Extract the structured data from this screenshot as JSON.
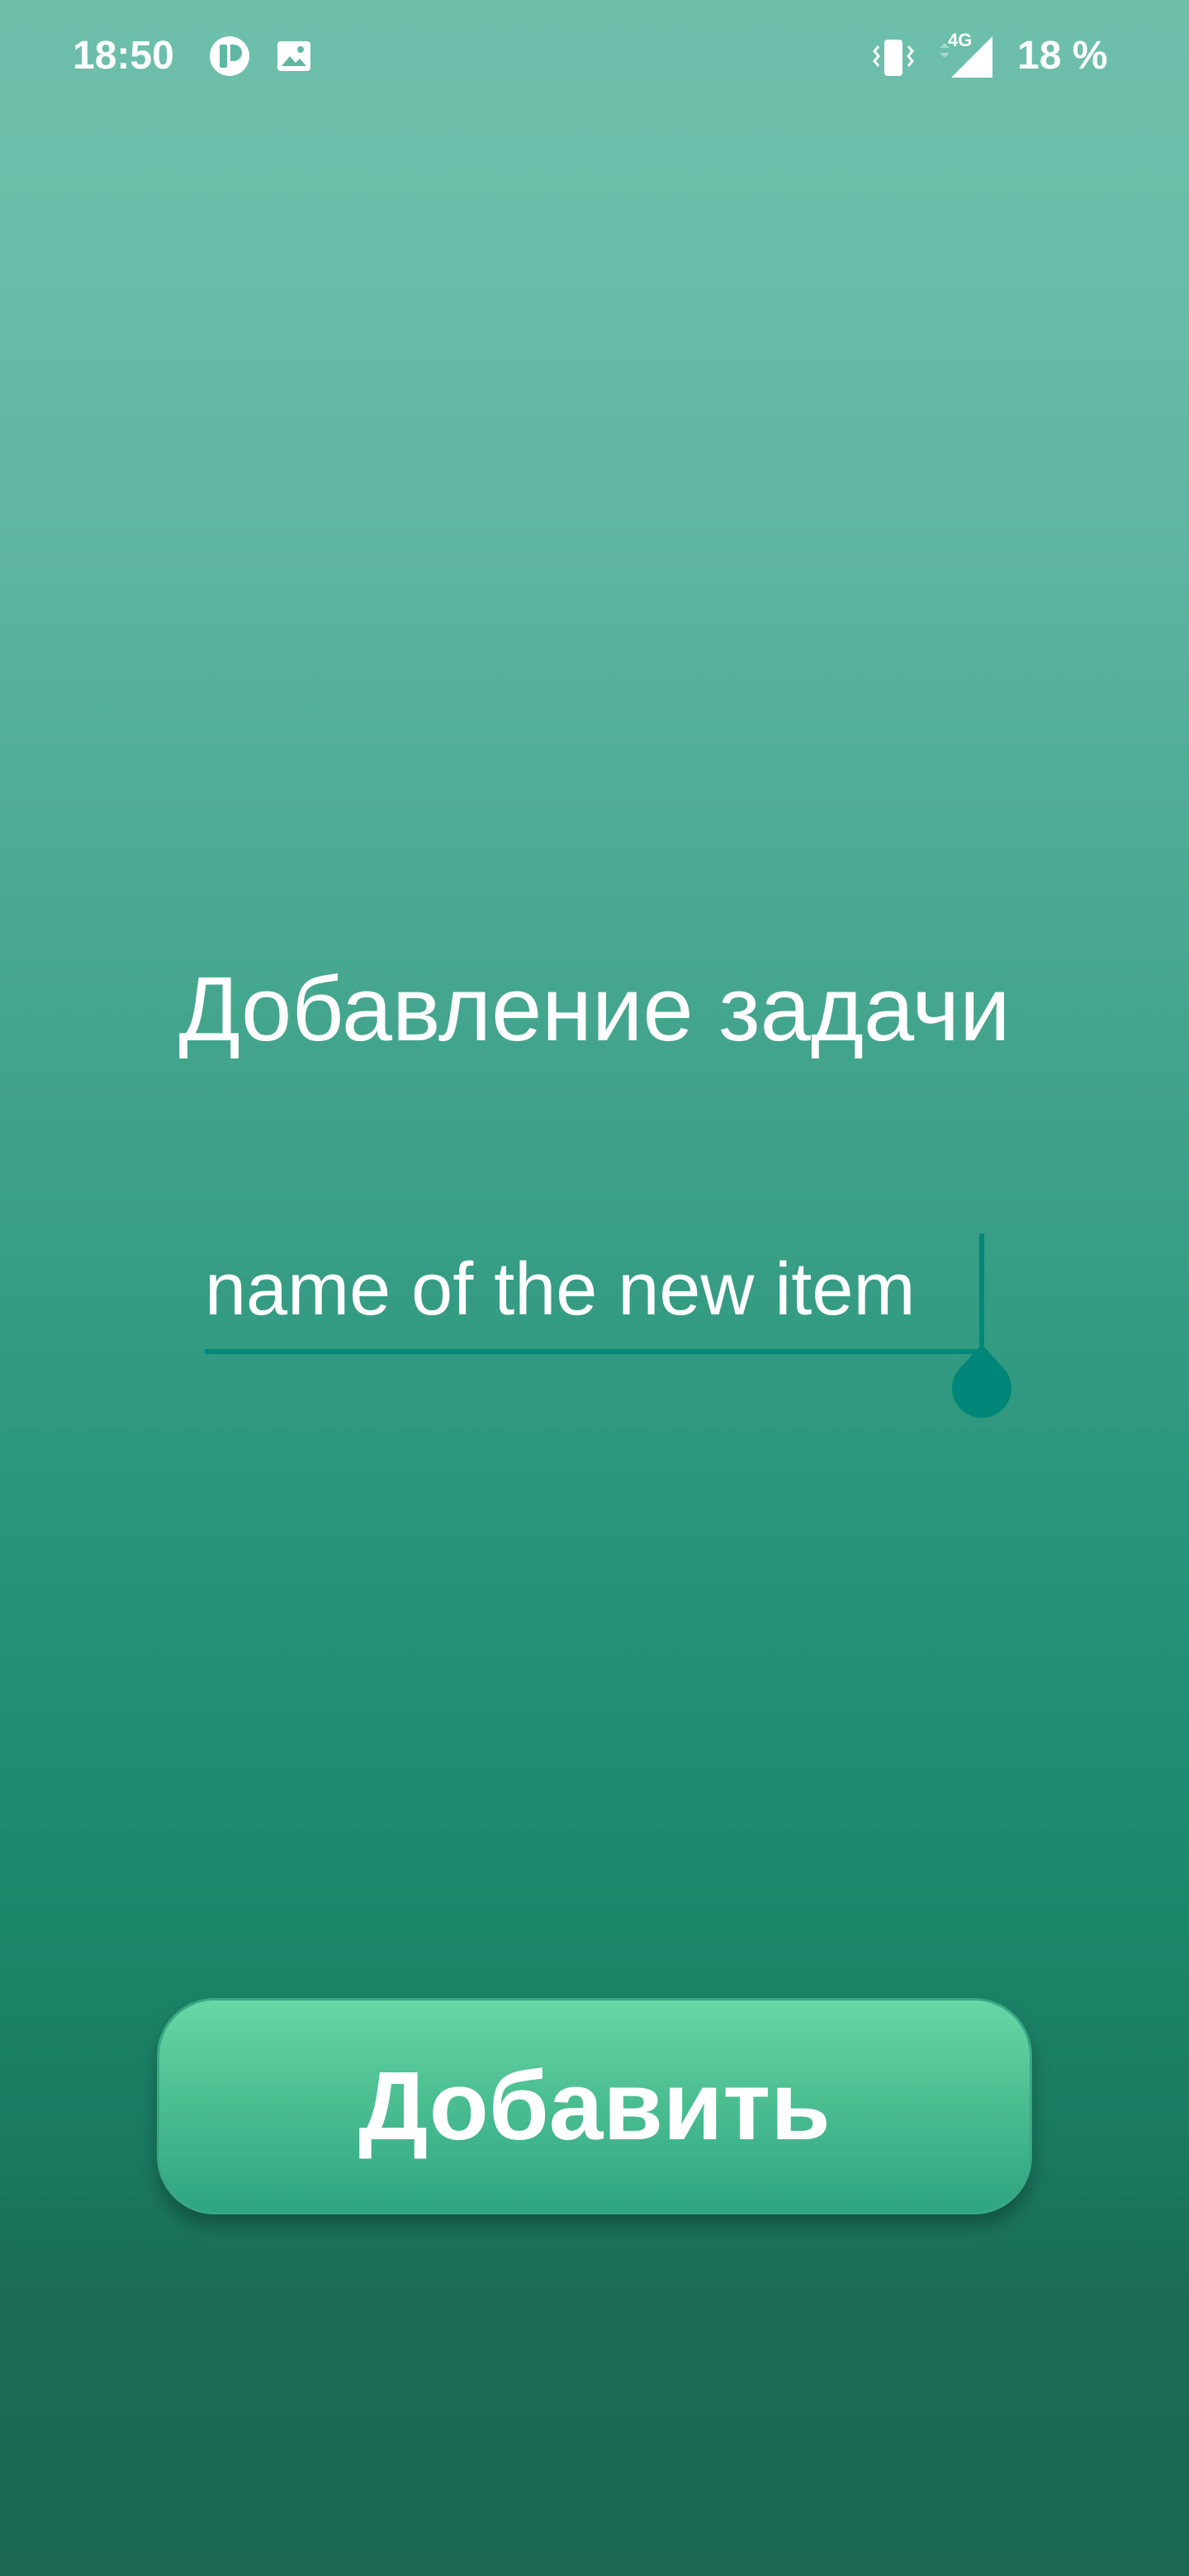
{
  "status_bar": {
    "time": "18:50",
    "network_type": "4G",
    "battery": "18 %",
    "icons": [
      "app-notification-icon",
      "gallery-icon",
      "vibrate-icon",
      "signal-icon"
    ]
  },
  "main": {
    "title": "Добавление задачи",
    "input": {
      "value": "name of the new item",
      "placeholder": ""
    },
    "add_button_label": "Добавить"
  },
  "colors": {
    "background_top": "#6dbfaa",
    "background_bottom": "#1b6754",
    "accent": "#00877a",
    "button_top": "#69d6a6",
    "button_bottom": "#2fa482",
    "text": "#ffffff"
  }
}
